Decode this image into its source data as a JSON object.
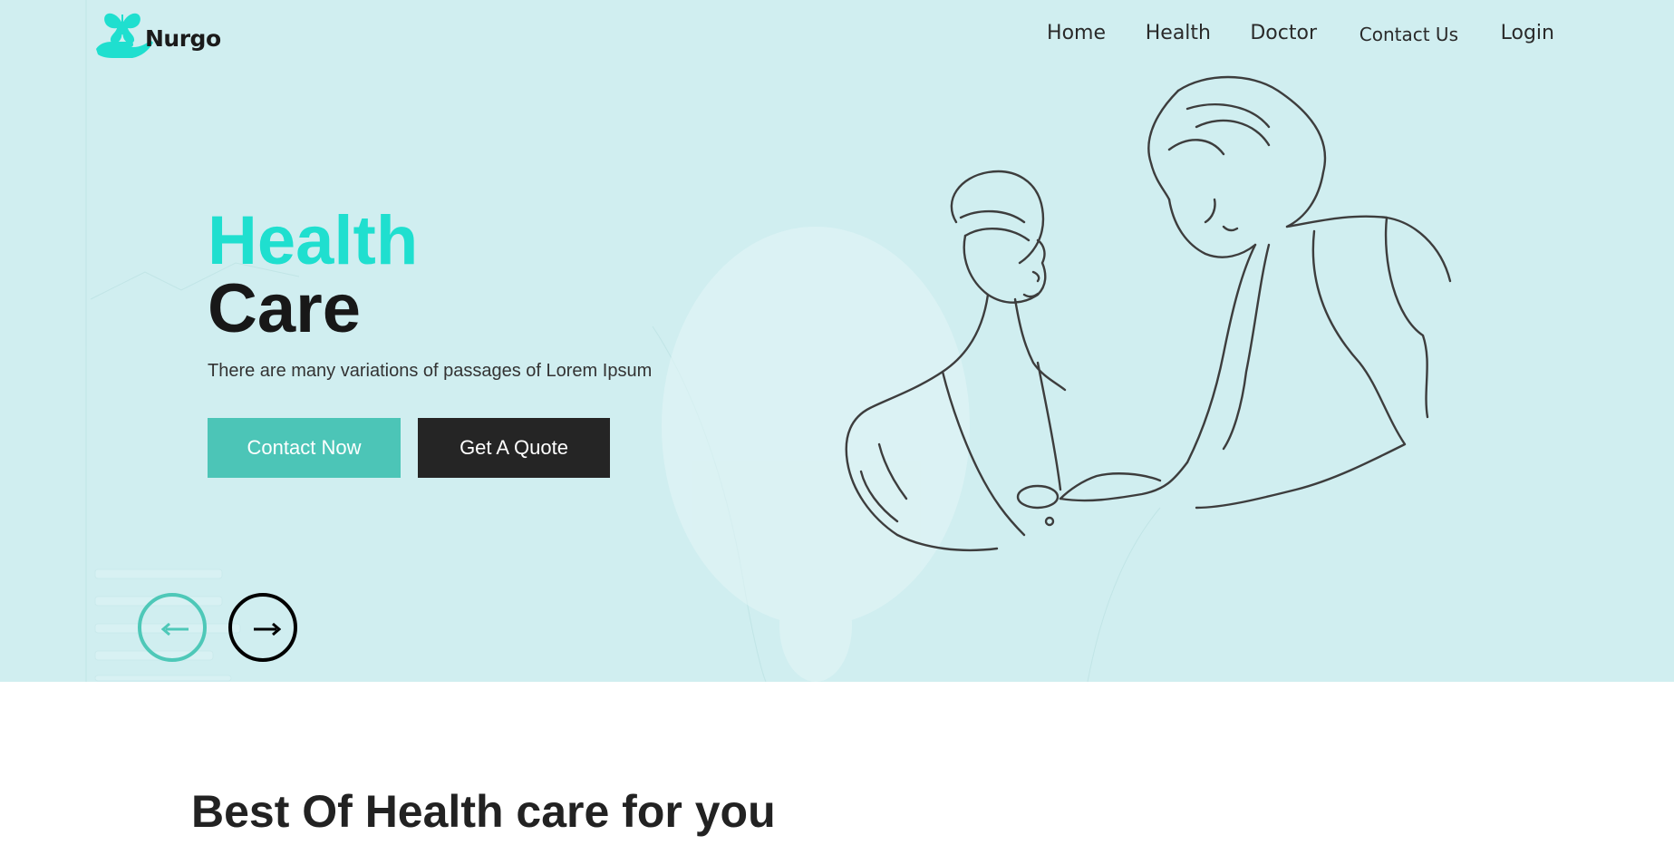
{
  "brand": {
    "name": "Nurgo"
  },
  "nav": {
    "items": [
      "Home",
      "Health",
      "Doctor",
      "Contact Us",
      "Login"
    ]
  },
  "hero": {
    "title_line1": "Health",
    "title_line2": "Care",
    "subtitle": "There are many variations of passages of Lorem Ipsum",
    "buttons": {
      "contact": "Contact Now",
      "quote": "Get A Quote"
    },
    "prev_icon": "arrow-left-icon",
    "next_icon": "arrow-right-icon"
  },
  "section": {
    "title": "Best Of Health care for you"
  },
  "colors": {
    "hero_bg": "#d0eef0",
    "accent": "#1fdfcf",
    "button_teal": "#4cc5b7",
    "button_dark": "#252525"
  }
}
